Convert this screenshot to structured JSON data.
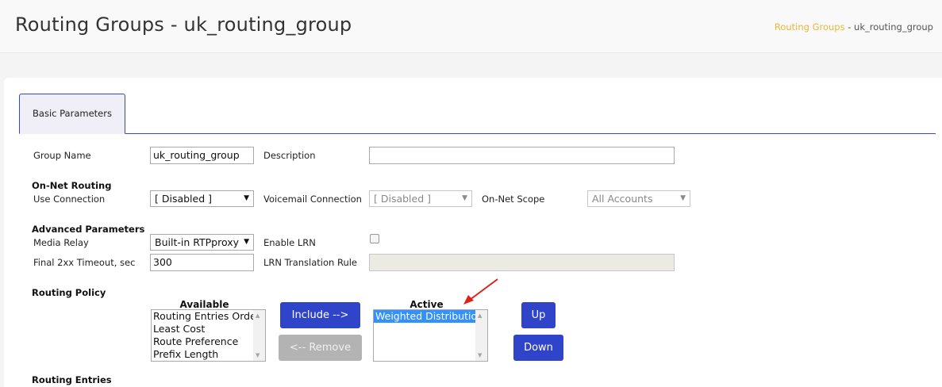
{
  "header": {
    "title": "Routing Groups - uk_routing_group",
    "breadcrumb_link": "Routing Groups",
    "breadcrumb_sep": " - ",
    "breadcrumb_current": "uk_routing_group"
  },
  "tabs": [
    {
      "label": "Basic Parameters",
      "active": true
    }
  ],
  "form": {
    "group_name_label": "Group Name",
    "group_name_value": "uk_routing_group",
    "description_label": "Description",
    "description_value": "",
    "onnet_section": "On-Net Routing",
    "use_connection_label": "Use Connection",
    "use_connection_value": "[ Disabled ]",
    "voicemail_connection_label": "Voicemail Connection",
    "voicemail_connection_value": "[ Disabled ]",
    "onnet_scope_label": "On-Net Scope",
    "onnet_scope_value": "All Accounts",
    "advanced_section": "Advanced Parameters",
    "media_relay_label": "Media Relay",
    "media_relay_value": "Built-in RTPproxy",
    "enable_lrn_label": "Enable LRN",
    "enable_lrn_checked": false,
    "final_timeout_label": "Final 2xx Timeout, sec",
    "final_timeout_value": "300",
    "lrn_rule_label": "LRN Translation Rule",
    "lrn_rule_value": "",
    "routing_policy_section": "Routing Policy",
    "available_header": "Available",
    "available_options": [
      "Routing Entries Order",
      "Least Cost",
      "Route Preference",
      "Prefix Length"
    ],
    "active_header": "Active",
    "active_options": [
      "Weighted Distribution"
    ],
    "include_button": "Include -->",
    "remove_button": "<-- Remove",
    "up_button": "Up",
    "down_button": "Down",
    "routing_entries_section": "Routing Entries"
  },
  "colors": {
    "primary_button": "#2f44c9",
    "breadcrumb_link": "#e8b83a",
    "selected_option": "#3390ff",
    "annotation_arrow": "#e0201c"
  }
}
